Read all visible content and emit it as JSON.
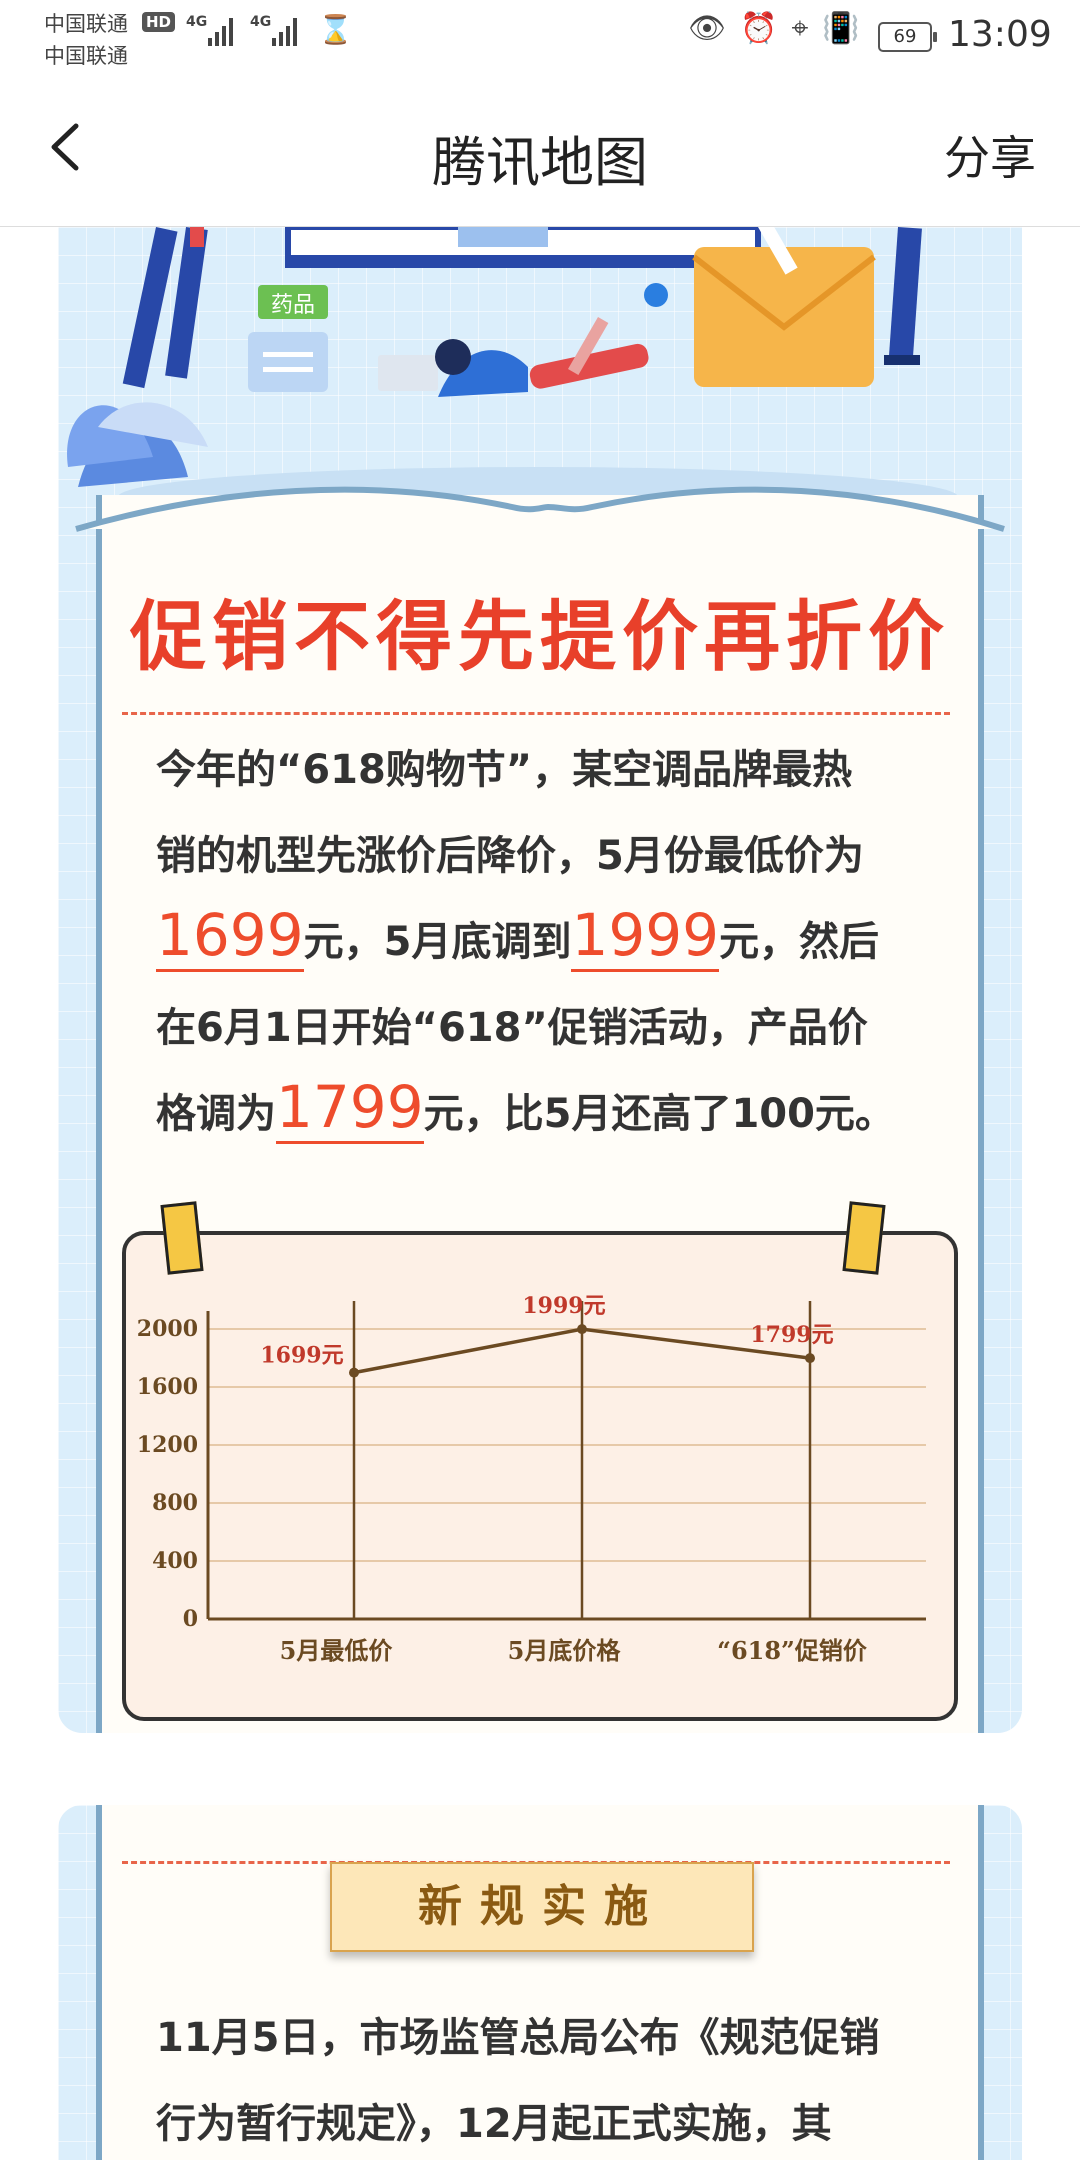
{
  "status_bar": {
    "carrier1": "中国联通",
    "carrier2": "中国联通",
    "hd": "HD",
    "net1": "4G",
    "net2": "4G",
    "battery": "69",
    "time": "13:09"
  },
  "nav": {
    "title": "腾讯地图",
    "share": "分享"
  },
  "article": {
    "illustration_tag": "药品",
    "headline": "促销不得先提价再折价",
    "para1": {
      "line1": "今年的“618购物节”，某空调品牌最热",
      "line2": "销的机型先涨价后降价，5月份最低价为",
      "price1": "1699",
      "unit1": "元，5月底调到",
      "price2": "1999",
      "unit2": "元，然后",
      "line4": "在6月1日开始“618”促销活动，产品价",
      "line5a": "格调为",
      "price3": "1799",
      "line5b": "元，比5月还高了100元。"
    },
    "section2_title": "新规实施",
    "para2": {
      "line1": "11月5日，市场监管总局公布《规范促销",
      "line2": "行为暂行规定》，12月起正式实施，其"
    }
  },
  "chart_data": {
    "type": "line",
    "categories": [
      "5月最低价",
      "5月底价格",
      "“618”促销价"
    ],
    "values": [
      1699,
      1999,
      1799
    ],
    "data_labels": [
      "1699元",
      "1999元",
      "1799元"
    ],
    "yticks": [
      "0",
      "400",
      "800",
      "1200",
      "1600",
      "2000"
    ],
    "ylim": [
      0,
      2000
    ],
    "title": "",
    "xlabel": "",
    "ylabel": "",
    "grid": true,
    "colors": {
      "line": "#6b4a22",
      "label": "#c0392b",
      "axis": "#6b4a22",
      "grid": "#e6c9a8"
    }
  }
}
